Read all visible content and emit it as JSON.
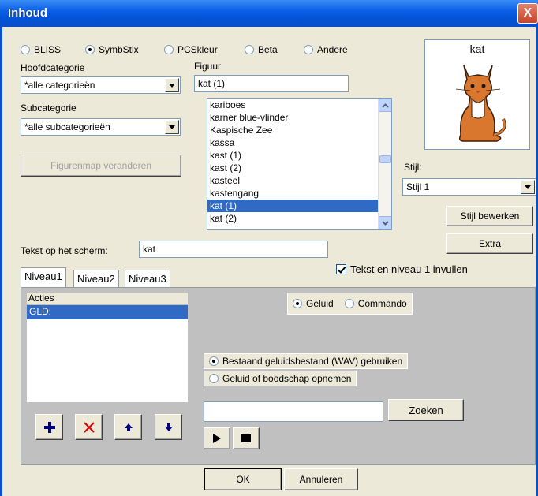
{
  "window": {
    "title": "Inhoud",
    "close": "X"
  },
  "symbol_sets": [
    {
      "label": "BLISS",
      "selected": false
    },
    {
      "label": "SymbStix",
      "selected": true
    },
    {
      "label": "PCSkleur",
      "selected": false
    },
    {
      "label": "Beta",
      "selected": false
    },
    {
      "label": "Andere",
      "selected": false
    }
  ],
  "hoofdcategorie": {
    "label": "Hoofdcategorie",
    "value": "*alle categorieën"
  },
  "subcategorie": {
    "label": "Subcategorie",
    "value": "*alle subcategorieën"
  },
  "figuur": {
    "label": "Figuur",
    "value": "kat (1)",
    "items": [
      "kariboes",
      "karner blue-vlinder",
      "Kaspische Zee",
      "kassa",
      "kast (1)",
      "kast (2)",
      "kasteel",
      "kastengang",
      "kat (1)",
      "kat (2)"
    ],
    "selected_index": 8
  },
  "figurenmap_button": "Figurenmap veranderen",
  "preview": {
    "caption": "kat"
  },
  "stijl": {
    "label": "Stijl:",
    "value": "Stijl 1"
  },
  "stijl_bewerken_button": "Stijl bewerken",
  "extra_button": "Extra",
  "tekst_op_scherm": {
    "label": "Tekst op het scherm:",
    "value": "kat"
  },
  "tekst_niveau_checkbox": {
    "label": "Tekst en niveau 1 invullen",
    "checked": true
  },
  "tabs": [
    "Niveau1",
    "Niveau2",
    "Niveau3"
  ],
  "acties": {
    "header": "Acties",
    "items": [
      "GLD:"
    ]
  },
  "action_type": [
    {
      "label": "Geluid",
      "selected": true
    },
    {
      "label": "Commando",
      "selected": false
    }
  ],
  "sound_source": [
    {
      "label": "Bestaand geluidsbestand (WAV) gebruiken",
      "selected": true
    },
    {
      "label": "Geluid of boodschap opnemen",
      "selected": false
    }
  ],
  "sound_file": {
    "value": ""
  },
  "zoeken_button": "Zoeken",
  "ok_button": "OK",
  "annuleren_button": "Annuleren",
  "colors": {
    "titlebar": "#0A4FC8",
    "selection": "#316AC5",
    "panel": "#C0C0C0",
    "add_icon": "#00007F",
    "delete_icon": "#E00000"
  }
}
